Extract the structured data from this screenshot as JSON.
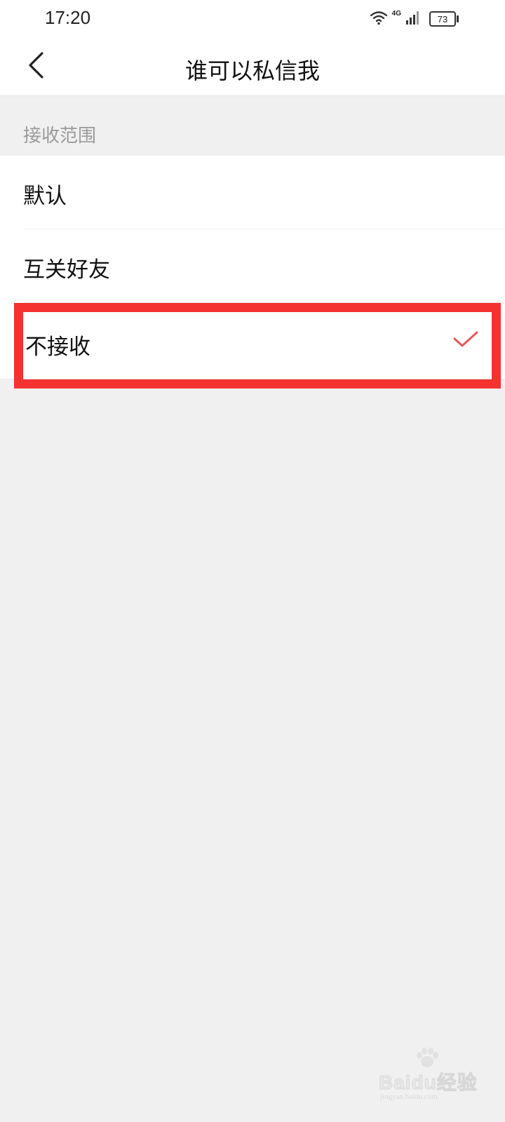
{
  "status_bar": {
    "time": "17:20",
    "network": "4G",
    "battery_level": "73"
  },
  "nav": {
    "back_icon": "chevron-left-icon",
    "title": "谁可以私信我"
  },
  "section": {
    "header": "接收范围"
  },
  "options": [
    {
      "label": "默认",
      "selected": false
    },
    {
      "label": "互关好友",
      "selected": false
    },
    {
      "label": "不接收",
      "selected": true
    }
  ],
  "colors": {
    "highlight": "#f4322f",
    "check": "#e5575a",
    "background": "#f0f0f0"
  },
  "watermark": {
    "text": "Baidu经验",
    "sub": "jingyan.baidu.com"
  }
}
